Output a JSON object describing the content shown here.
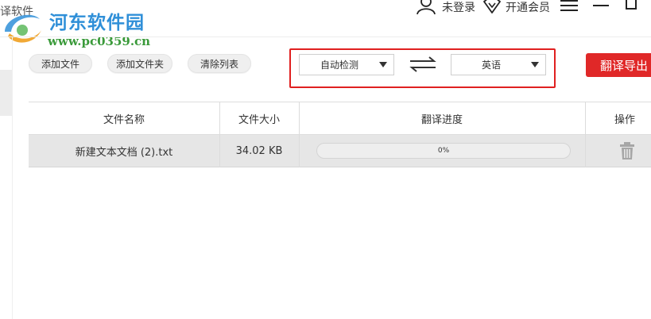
{
  "window": {
    "title_fragment": "译软件"
  },
  "watermark": {
    "name": "河东软件园",
    "url": "www.pc0359.cn"
  },
  "header": {
    "login_label": "未登录",
    "vip_label": "开通会员",
    "icons": [
      "user-icon",
      "vip-diamond-icon",
      "menu-icon",
      "minimize-icon",
      "maximize-icon"
    ]
  },
  "toolbar": {
    "add_file": "添加文件",
    "add_folder": "添加文件夹",
    "clear_list": "清除列表",
    "export": "翻译导出"
  },
  "language": {
    "source": "自动检测",
    "target": "英语",
    "highlight_color": "#e02020"
  },
  "table": {
    "columns": [
      "文件名称",
      "文件大小",
      "翻译进度",
      "操作"
    ],
    "rows": [
      {
        "name": "新建文本文档 (2).txt",
        "size": "34.02 KB",
        "progress_label": "0%",
        "progress": 0
      }
    ]
  },
  "colors": {
    "accent": "#e02828",
    "watermark_blue": "#2f8fd8",
    "watermark_green": "#3a9a3a"
  }
}
